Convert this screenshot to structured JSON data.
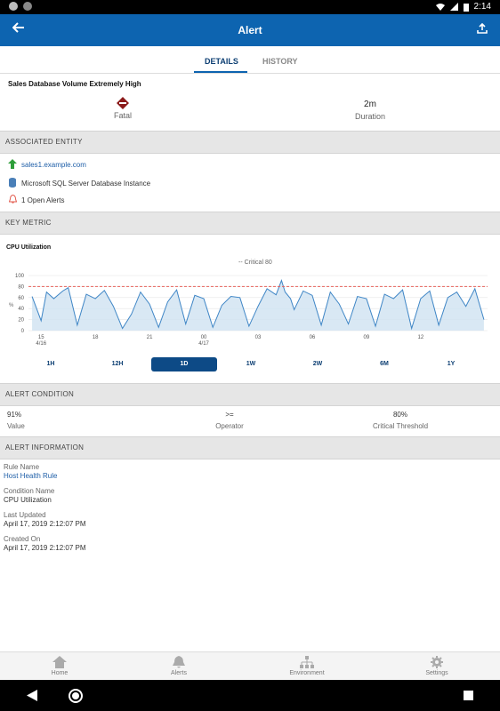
{
  "status_bar": {
    "time": "2:14"
  },
  "app_bar": {
    "title": "Alert"
  },
  "tabs": [
    {
      "label": "DETAILS",
      "active": true
    },
    {
      "label": "HISTORY",
      "active": false
    }
  ],
  "alert": {
    "name": "Sales Database Volume Extremely High",
    "severity_value": "Fatal",
    "duration_value": "2m",
    "duration_label": "Duration"
  },
  "associated_entity": {
    "header": "ASSOCIATED ENTITY",
    "host": "sales1.example.com",
    "instance": "Microsoft SQL Server Database Instance",
    "open_alerts": "1 Open Alerts"
  },
  "key_metric": {
    "header": "KEY METRIC",
    "metric_name": "CPU Utilization",
    "threshold_legend": "-- Critical 80",
    "y_unit": "%",
    "y_ticks": [
      "100",
      "80",
      "60",
      "40",
      "20",
      "0"
    ],
    "x_ticks": [
      "15",
      "18",
      "21",
      "00",
      "03",
      "06",
      "09",
      "12"
    ],
    "x_subticks": [
      "4/16",
      "",
      "",
      "4/17",
      "",
      "",
      "",
      ""
    ]
  },
  "chart_data": {
    "type": "area",
    "title": "CPU Utilization",
    "ylabel": "%",
    "ylim": [
      0,
      100
    ],
    "threshold": {
      "name": "Critical 80",
      "value": 80,
      "color": "#e8625c"
    },
    "peak": {
      "hour": 4.5,
      "value": 91
    },
    "x_hours": [
      14.5,
      15,
      15.3,
      15.7,
      16.2,
      16.5,
      17,
      17.5,
      18,
      18.5,
      19,
      19.5,
      20,
      20.5,
      21,
      21.5,
      22,
      22.5,
      23,
      23.5,
      24,
      24.5,
      25,
      25.5,
      26,
      26.5,
      27,
      27.5,
      28,
      28.3,
      28.5,
      28.8,
      29,
      29.5,
      30,
      30.5,
      31,
      31.5,
      32,
      32.5,
      33,
      33.5,
      34,
      34.5,
      35,
      35.5,
      36,
      36.5,
      37,
      37.5,
      38,
      38.5,
      39,
      39.5
    ],
    "values": [
      62,
      18,
      70,
      58,
      72,
      78,
      10,
      66,
      58,
      73,
      44,
      4,
      30,
      70,
      48,
      6,
      52,
      74,
      12,
      64,
      58,
      6,
      46,
      62,
      60,
      8,
      44,
      76,
      65,
      91,
      70,
      58,
      38,
      72,
      64,
      10,
      70,
      48,
      12,
      62,
      58,
      8,
      66,
      58,
      74,
      4,
      58,
      72,
      10,
      60,
      70,
      44,
      76,
      20
    ],
    "x_ticks": [
      {
        "hour": 15,
        "label": "15"
      },
      {
        "hour": 18,
        "label": "18"
      },
      {
        "hour": 21,
        "label": "21"
      },
      {
        "hour": 24,
        "label": "00"
      },
      {
        "hour": 27,
        "label": "03"
      },
      {
        "hour": 30,
        "label": "06"
      },
      {
        "hour": 33,
        "label": "09"
      },
      {
        "hour": 36,
        "label": "12"
      }
    ],
    "x_sub_labels": [
      {
        "hour": 15,
        "label": "4/16"
      },
      {
        "hour": 24,
        "label": "4/17"
      }
    ],
    "line_color": "#3f86c6",
    "fill_color": "#cfe2f1"
  },
  "time_ranges": [
    {
      "label": "1H",
      "active": false
    },
    {
      "label": "12H",
      "active": false
    },
    {
      "label": "1D",
      "active": true
    },
    {
      "label": "1W",
      "active": false
    },
    {
      "label": "2W",
      "active": false
    },
    {
      "label": "6M",
      "active": false
    },
    {
      "label": "1Y",
      "active": false
    }
  ],
  "alert_condition": {
    "header": "ALERT CONDITION",
    "value": "91%",
    "value_label": "Value",
    "operator": ">=",
    "operator_label": "Operator",
    "threshold": "80%",
    "threshold_label": "Critical Threshold"
  },
  "alert_information": {
    "header": "ALERT INFORMATION",
    "rule_name_label": "Rule Name",
    "rule_name": "Host Health Rule",
    "condition_name_label": "Condition Name",
    "condition_name": "CPU Utilization",
    "last_updated_label": "Last Updated",
    "last_updated": "April 17, 2019 2:12:07 PM",
    "created_on_label": "Created On",
    "created_on": "April 17, 2019 2:12:07 PM"
  },
  "bottom_nav": [
    {
      "label": "Home",
      "icon": "home-icon"
    },
    {
      "label": "Alerts",
      "icon": "bell-icon"
    },
    {
      "label": "Environment",
      "icon": "hierarchy-icon"
    },
    {
      "label": "Settings",
      "icon": "gear-icon"
    }
  ],
  "colors": {
    "primary": "#0d64b0",
    "fatal": "#8b1a1a",
    "up": "#2e9e3a",
    "alert": "#e35b4e"
  }
}
